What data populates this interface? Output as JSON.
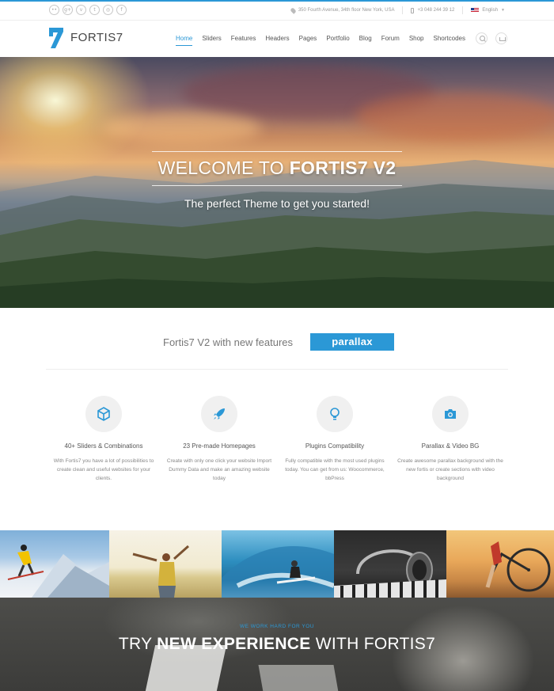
{
  "colors": {
    "accent": "#2b98d6"
  },
  "topbar": {
    "social_icons": [
      "flickr-icon",
      "google-plus-icon",
      "vimeo-icon",
      "twitter-icon",
      "dribbble-icon",
      "facebook-icon"
    ],
    "social_glyphs": [
      "••",
      "g+",
      "v",
      "t",
      "◎",
      "f"
    ],
    "address": "350 Fourth Avenue, 34th floor New York, USA",
    "phone": "+3 048 244 39 12",
    "language": "English"
  },
  "header": {
    "logo_text": "FORTIS7",
    "nav": [
      "Home",
      "Sliders",
      "Features",
      "Headers",
      "Pages",
      "Portfolio",
      "Blog",
      "Forum",
      "Shop",
      "Shortcodes"
    ],
    "active_nav": "Home"
  },
  "hero": {
    "title_light": "WELCOME TO",
    "title_bold": "FORTIS7 V2",
    "subtitle": "The perfect Theme to get you started!"
  },
  "features_heading": {
    "text": "Fortis7 V2 with new features",
    "badge": "parallax"
  },
  "features": [
    {
      "icon": "cube-icon",
      "title": "40+ Sliders & Combinations",
      "desc": "With Fortis7 you have a lot of possibilities to create clean and useful websites for your clients."
    },
    {
      "icon": "rocket-icon",
      "title": "23 Pre-made Homepages",
      "desc": "Create with only one click your website Import Dummy Data and make an amazing website today"
    },
    {
      "icon": "lightbulb-icon",
      "title": "Plugins Compatibility",
      "desc": "Fully compatible with the most used plugins today. You can get from us: Woocommerce, bbPress"
    },
    {
      "icon": "camera-icon",
      "title": "Parallax & Video BG",
      "desc": "Create awesome parallax background with the new fortis or create sections with video background"
    }
  ],
  "gallery": [
    "skier-photo",
    "woman-in-field-photo",
    "surfer-photo",
    "headphones-photo",
    "bicycle-photo"
  ],
  "banner": {
    "tagline": "WE WORK HARD FOR YOU",
    "heading_pre": "TRY",
    "heading_bold": "NEW EXPERIENCE",
    "heading_post": "WITH FORTIS7"
  }
}
